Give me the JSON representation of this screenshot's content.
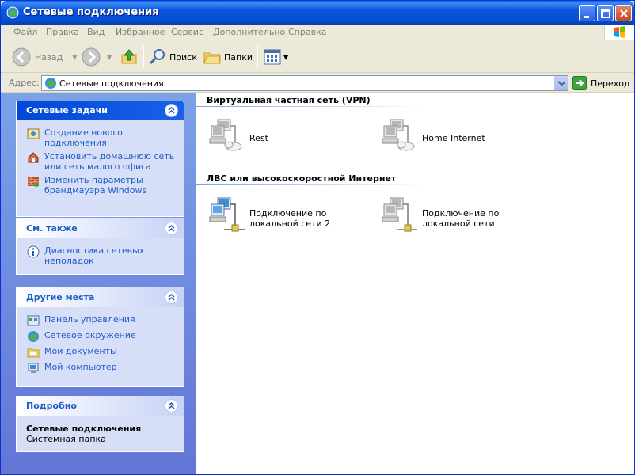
{
  "window": {
    "title": "Сетевые подключения"
  },
  "menu": {
    "items": [
      "Файл",
      "Правка",
      "Вид",
      "Избранное",
      "Сервис",
      "Дополнительно",
      "Справка"
    ]
  },
  "toolbar": {
    "back": "Назад",
    "search": "Поиск",
    "folders": "Папки"
  },
  "address": {
    "label": "Адрес:",
    "value": "Сетевые подключения",
    "go": "Переход"
  },
  "taskpane": {
    "network_tasks": {
      "title": "Сетевые задачи",
      "items": [
        "Создание нового подключения",
        "Установить домашнюю сеть или сеть малого офиса",
        "Изменить параметры брандмауэра Windows"
      ]
    },
    "see_also": {
      "title": "См. также",
      "items": [
        "Диагностика сетевых неполадок"
      ]
    },
    "other_places": {
      "title": "Другие места",
      "items": [
        "Панель управления",
        "Сетевое окружение",
        "Мои документы",
        "Мой компьютер"
      ]
    },
    "details": {
      "title": "Подробно",
      "name": "Сетевые подключения",
      "type": "Системная папка"
    }
  },
  "content": {
    "groups": [
      {
        "title": "Виртуальная частная сеть (VPN)",
        "items": [
          "Rest",
          "Home Internet"
        ]
      },
      {
        "title": "ЛВС или высокоскоростной Интернет",
        "items": [
          "Подключение по локальной сети 2",
          "Подключение по локальной сети"
        ]
      }
    ]
  }
}
